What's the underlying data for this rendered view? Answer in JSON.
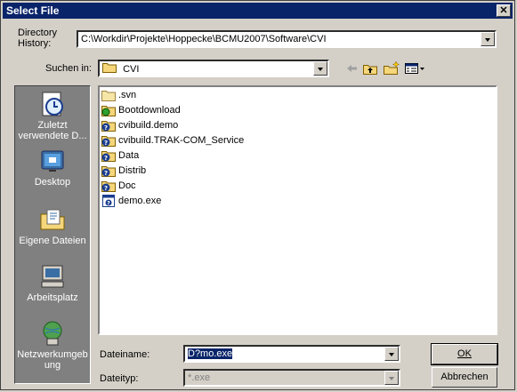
{
  "window": {
    "title": "Select File",
    "close_label": "✕"
  },
  "history": {
    "label_line1": "Directory",
    "label_line2": "History:",
    "value": "C:\\Workdir\\Projekte\\Hoppecke\\BCMU2007\\Software\\CVI"
  },
  "lookin": {
    "label": "Suchen in:",
    "value": "CVI"
  },
  "toolbar": {
    "back_icon": "back-arrow-icon",
    "up_icon": "folder-up-icon",
    "new_folder_icon": "new-folder-icon",
    "view_icon": "view-menu-icon"
  },
  "places": [
    {
      "label": "Zuletzt verwendete D...",
      "icon": "recent-icon"
    },
    {
      "label": "Desktop",
      "icon": "desktop-icon"
    },
    {
      "label": "Eigene Dateien",
      "icon": "my-documents-icon"
    },
    {
      "label": "Arbeitsplatz",
      "icon": "my-computer-icon"
    },
    {
      "label": "Netzwerkumgebung",
      "icon": "network-icon"
    }
  ],
  "files": [
    {
      "name": ".svn",
      "type": "folder"
    },
    {
      "name": "Bootdownload",
      "type": "folder-special"
    },
    {
      "name": "cvibuild.demo",
      "type": "folder-help"
    },
    {
      "name": "cvibuild.TRAK-COM_Service",
      "type": "folder-help"
    },
    {
      "name": "Data",
      "type": "folder-help"
    },
    {
      "name": "Distrib",
      "type": "folder-help"
    },
    {
      "name": "Doc",
      "type": "folder-help"
    },
    {
      "name": "demo.exe",
      "type": "file-help"
    }
  ],
  "filename": {
    "label": "Dateiname:",
    "value": "D?mo.exe"
  },
  "filetype": {
    "label": "Dateityp:",
    "value": "*.exe"
  },
  "buttons": {
    "ok": "OK",
    "cancel": "Abbrechen"
  }
}
